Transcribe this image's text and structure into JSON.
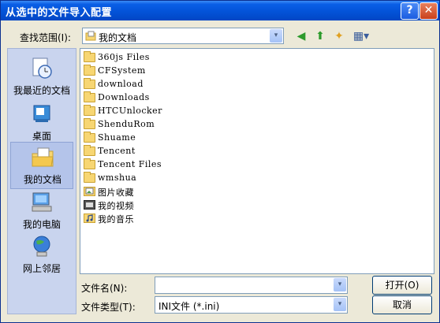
{
  "window": {
    "title": "从选中的文件导入配置",
    "help_symbol": "?",
    "close_symbol": "✕"
  },
  "lookin": {
    "label": "查找范围(I):",
    "value": "我的文档",
    "dropdown_symbol": "▾"
  },
  "toolbar": [
    {
      "name": "back",
      "icon": "back-icon",
      "glyph": "◀"
    },
    {
      "name": "up",
      "icon": "up-folder-icon",
      "glyph": "⬆"
    },
    {
      "name": "new-folder",
      "icon": "new-folder-icon",
      "glyph": "✦"
    },
    {
      "name": "views",
      "icon": "views-menu-icon",
      "glyph": "▦▾"
    }
  ],
  "places": [
    {
      "label": "我最近的文档",
      "icon": "recent-documents-icon"
    },
    {
      "label": "桌面",
      "icon": "desktop-icon"
    },
    {
      "label": "我的文档",
      "icon": "my-documents-icon",
      "selected": true
    },
    {
      "label": "我的电脑",
      "icon": "my-computer-icon"
    },
    {
      "label": "网上邻居",
      "icon": "network-places-icon"
    }
  ],
  "files": [
    {
      "name": "360js Files",
      "icon": "folder-icon"
    },
    {
      "name": "CFSystem",
      "icon": "folder-icon"
    },
    {
      "name": "download",
      "icon": "folder-icon"
    },
    {
      "name": "Downloads",
      "icon": "folder-icon"
    },
    {
      "name": "HTCUnlocker",
      "icon": "folder-icon"
    },
    {
      "name": "ShenduRom",
      "icon": "folder-icon"
    },
    {
      "name": "Shuame",
      "icon": "folder-icon"
    },
    {
      "name": "Tencent",
      "icon": "folder-icon"
    },
    {
      "name": "Tencent Files",
      "icon": "folder-icon"
    },
    {
      "name": "wmshua",
      "icon": "folder-icon"
    },
    {
      "name": "图片收藏",
      "icon": "pictures-folder-icon"
    },
    {
      "name": "我的视频",
      "icon": "videos-folder-icon"
    },
    {
      "name": "我的音乐",
      "icon": "music-folder-icon"
    }
  ],
  "filename": {
    "label": "文件名(N):",
    "value": ""
  },
  "filetype": {
    "label": "文件类型(T):",
    "value": "INI文件 (*.ini)"
  },
  "buttons": {
    "open": "打开(O)",
    "cancel": "取消"
  },
  "colors": {
    "titlebar": "#0353d8",
    "places_bg": "#c9d4ee",
    "dialog_bg": "#ece9d8"
  }
}
